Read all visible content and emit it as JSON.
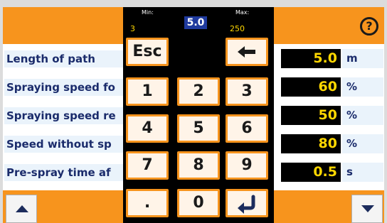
{
  "header": {
    "help_icon": "question-circle-icon",
    "help_glyph": "?"
  },
  "rows": [
    {
      "label": "Length of path",
      "value": "5.0",
      "unit": "m"
    },
    {
      "label": "Spraying speed fo",
      "value": "60",
      "unit": "%"
    },
    {
      "label": "Spraying speed re",
      "value": "50",
      "unit": "%"
    },
    {
      "label": "Speed without sp",
      "value": "80",
      "unit": "%"
    },
    {
      "label": "Pre-spray time af",
      "value": "0.5",
      "unit": "s"
    }
  ],
  "footer": {
    "up_icon": "arrow-up-icon",
    "down_icon": "arrow-down-icon"
  },
  "keypad": {
    "min_label": "Min:",
    "min_value": "3",
    "max_label": "Max:",
    "max_value": "250",
    "entry_value": "5.0",
    "keys": {
      "esc": "Esc",
      "backspace_icon": "backspace-arrow-icon",
      "k1": "1",
      "k2": "2",
      "k3": "3",
      "k4": "4",
      "k5": "5",
      "k6": "6",
      "k7": "7",
      "k8": "8",
      "k9": "9",
      "dot": ".",
      "k0": "0",
      "enter_icon": "enter-return-icon"
    }
  },
  "colors": {
    "accent": "#f7941d",
    "value_bg": "#000000",
    "value_text": "#ffd700",
    "label_text": "#1a2b6b",
    "label_bg": "#eaf3fb"
  }
}
